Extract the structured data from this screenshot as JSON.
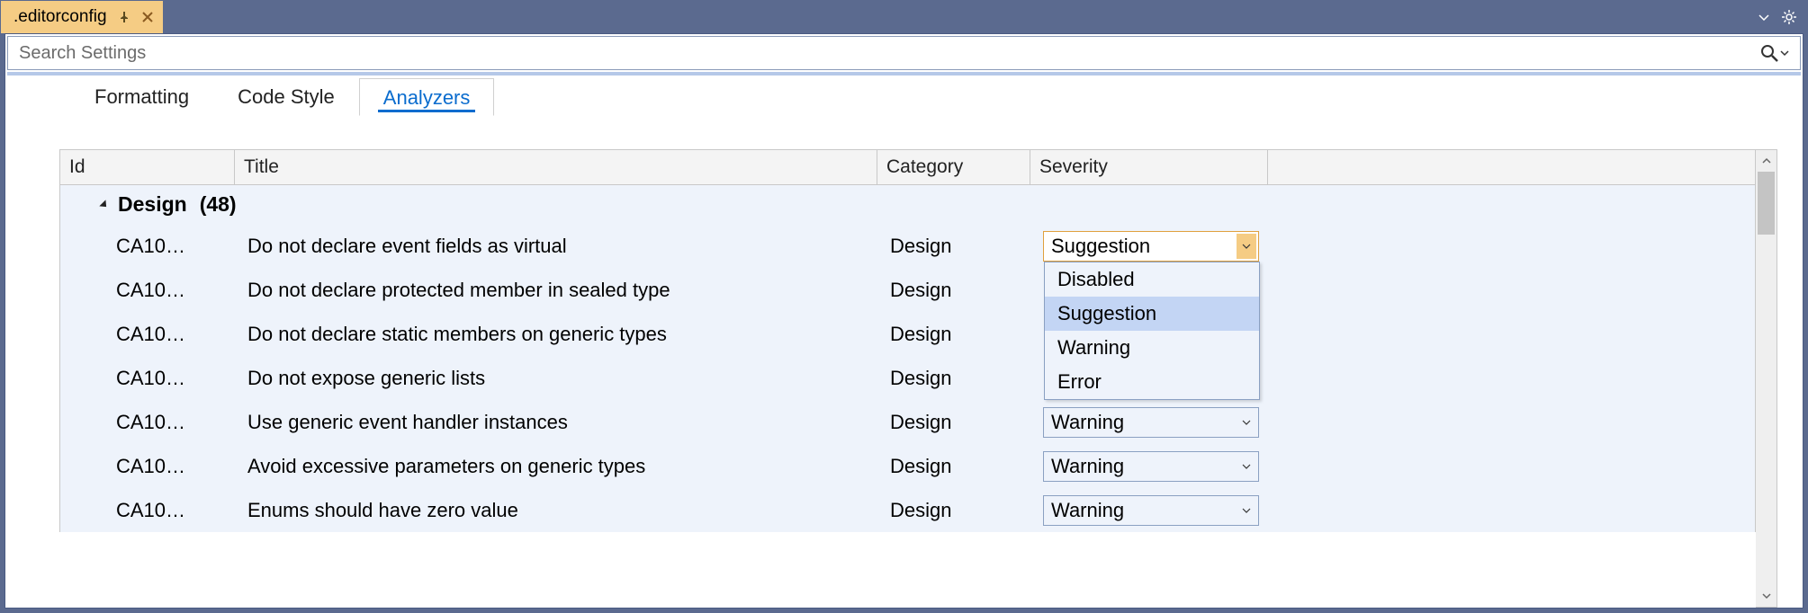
{
  "titlebar": {
    "filename": ".editorconfig"
  },
  "search": {
    "placeholder": "Search Settings"
  },
  "subtabs": [
    {
      "label": "Formatting",
      "active": false
    },
    {
      "label": "Code Style",
      "active": false
    },
    {
      "label": "Analyzers",
      "active": true
    }
  ],
  "columns": {
    "id": "Id",
    "title": "Title",
    "category": "Category",
    "severity": "Severity"
  },
  "group": {
    "name": "Design",
    "count": "(48)"
  },
  "rows": [
    {
      "id": "CA10…",
      "title": "Do not declare event fields as virtual",
      "category": "Design",
      "severity": "Suggestion",
      "open": true
    },
    {
      "id": "CA10…",
      "title": "Do not declare protected member in sealed type",
      "category": "Design",
      "severity": ""
    },
    {
      "id": "CA10…",
      "title": "Do not declare static members on generic types",
      "category": "Design",
      "severity": ""
    },
    {
      "id": "CA10…",
      "title": "Do not expose generic lists",
      "category": "Design",
      "severity": ""
    },
    {
      "id": "CA10…",
      "title": "Use generic event handler instances",
      "category": "Design",
      "severity": "Warning"
    },
    {
      "id": "CA10…",
      "title": "Avoid excessive parameters on generic types",
      "category": "Design",
      "severity": "Warning"
    },
    {
      "id": "CA10…",
      "title": "Enums should have zero value",
      "category": "Design",
      "severity": "Warning"
    }
  ],
  "severity_options": [
    "Disabled",
    "Suggestion",
    "Warning",
    "Error"
  ],
  "selected_option": "Suggestion"
}
